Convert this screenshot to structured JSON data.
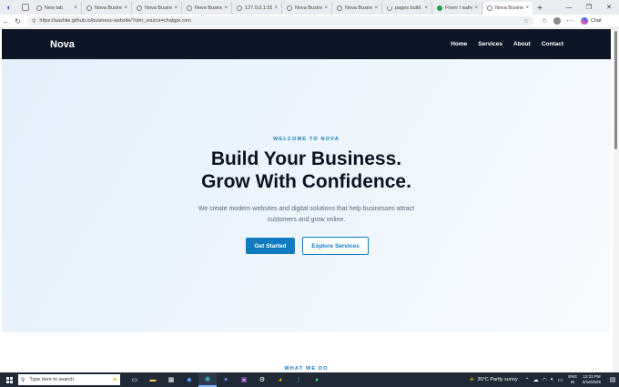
{
  "browser": {
    "tabs": [
      {
        "label": "New tab",
        "icon": "page-icon"
      },
      {
        "label": "Nova Business",
        "icon": "globe-icon"
      },
      {
        "label": "Nova Business",
        "icon": "globe-icon"
      },
      {
        "label": "Nova Business",
        "icon": "globe-icon"
      },
      {
        "label": "127.0.0.1:5500/",
        "icon": "globe-icon"
      },
      {
        "label": "Nova Business",
        "icon": "globe-icon"
      },
      {
        "label": "Nova Business",
        "icon": "globe-icon"
      },
      {
        "label": "pages build an",
        "icon": "loading-icon"
      },
      {
        "label": "Fiverr / aafreen",
        "icon": "fiverr-icon"
      },
      {
        "label": "Nova Business",
        "icon": "globe-icon",
        "active": true
      }
    ],
    "url": "https://aashiie.github.io/business-website/?utm_source=chatgpt.com",
    "chat_label": "Chat"
  },
  "site": {
    "brand": "Nova",
    "nav": [
      "Home",
      "Services",
      "About",
      "Contact"
    ],
    "hero": {
      "eyebrow": "WELCOME TO NOVA",
      "headline_line1": "Build Your Business.",
      "headline_line2": "Grow With Confidence.",
      "subtext": "We create modern websites and digital solutions that help businesses attract customers and grow online.",
      "primary_button": "Get Started",
      "secondary_button": "Explore Services"
    },
    "next_section_label": "WHAT WE DO",
    "colors": {
      "nav_bg": "#0d1626",
      "accent": "#127bbf",
      "headline": "#0c1220"
    }
  },
  "taskbar": {
    "search_placeholder": "Type here to search",
    "weather": "30°C  Partly sunny",
    "lang_top": "ENG",
    "lang_bottom": "IN",
    "time": "12:23 PM",
    "date": "8/16/2026"
  }
}
